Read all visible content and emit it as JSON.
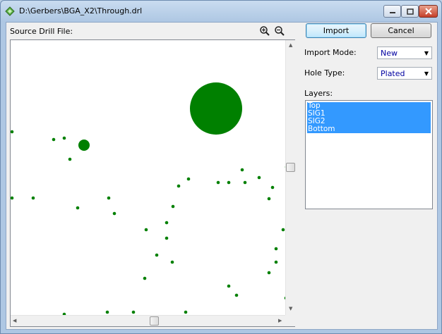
{
  "window": {
    "title": "D:\\Gerbers\\BGA_X2\\Through.drl"
  },
  "source": {
    "label": "Source Drill File:"
  },
  "buttons": {
    "import": "Import",
    "cancel": "Cancel"
  },
  "import_mode": {
    "label": "Import Mode:",
    "value": "New"
  },
  "hole_type": {
    "label": "Hole Type:",
    "value": "Plated"
  },
  "layers": {
    "label": "Layers:",
    "items": [
      "Top",
      "SIG1",
      "SIG2",
      "Bottom"
    ]
  },
  "colors": {
    "drill": "#008000",
    "selection": "#3399ff"
  },
  "icons": {
    "app": "gerber-diamond-icon",
    "zoom_in": "zoom-in-icon",
    "zoom_out": "zoom-out-icon"
  }
}
